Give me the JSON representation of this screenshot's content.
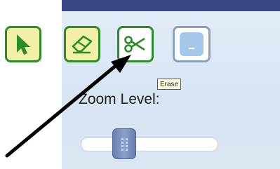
{
  "toolbar": {
    "tools": [
      {
        "name": "select",
        "icon": "cursor-arrow-icon",
        "active": true
      },
      {
        "name": "erase",
        "icon": "eraser-icon",
        "active": true
      },
      {
        "name": "cut",
        "icon": "scissors-icon",
        "active": false
      },
      {
        "name": "extra",
        "icon": "dropdown-box-icon",
        "active": false
      }
    ]
  },
  "tooltip": {
    "text": "Erase"
  },
  "zoom": {
    "label": "Zoom Level:",
    "level": 0.28
  },
  "annotation": {
    "icon": "pointer-arrow-icon"
  },
  "colors": {
    "header_bar": "#3a4683",
    "active_tool_bg": "#f2f0a8",
    "tool_border": "#2f8a2a",
    "slider_thumb": "#7b8fc2"
  }
}
